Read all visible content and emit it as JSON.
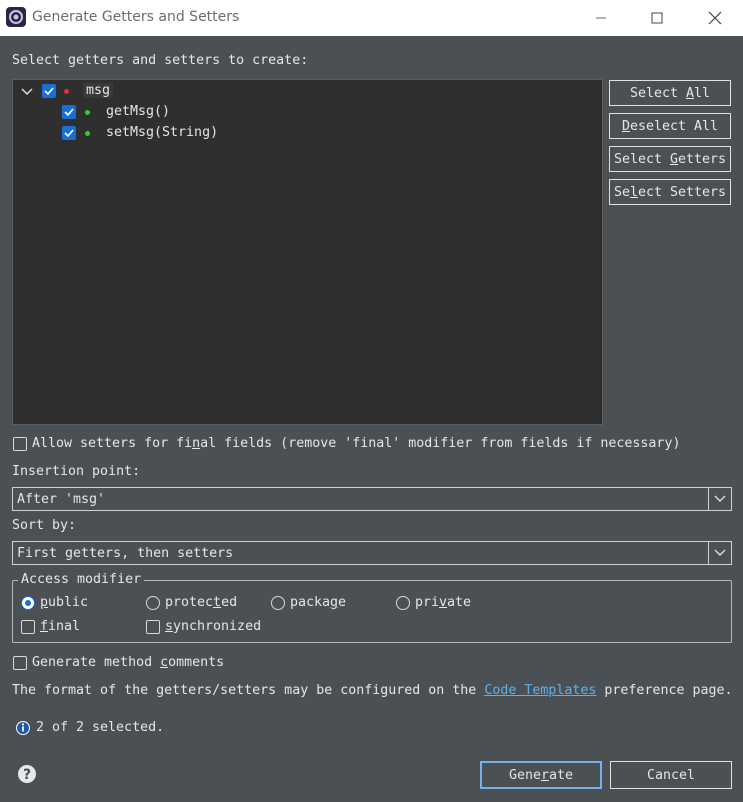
{
  "window": {
    "title": "Generate Getters and Setters",
    "minimize_icon": "minimize-icon",
    "maximize_icon": "maximize-icon",
    "close_icon": "close-icon"
  },
  "prompt": "Select getters and setters to create:",
  "tree": {
    "root": {
      "label": "msg",
      "checked": true,
      "icon": "field-private-icon"
    },
    "children": [
      {
        "label": "getMsg()",
        "checked": true,
        "icon": "method-public-icon"
      },
      {
        "label": "setMsg(String)",
        "checked": true,
        "icon": "method-public-icon"
      }
    ]
  },
  "side_buttons": {
    "select_all": {
      "pre": "Select ",
      "mn": "A",
      "post": "ll"
    },
    "deselect_all": {
      "pre": "",
      "mn": "D",
      "post": "eselect All"
    },
    "select_getters": {
      "pre": "Select ",
      "mn": "G",
      "post": "etters"
    },
    "select_setters": {
      "pre": "Se",
      "mn": "l",
      "post": "ect Setters"
    }
  },
  "allow_final": {
    "pre": "Allow setters for fi",
    "mn": "n",
    "post": "al fields (remove 'final' modifier from fields if necessary)",
    "checked": false
  },
  "insertion": {
    "label": "Insertion point:",
    "value": "After 'msg'"
  },
  "sort": {
    "label": "Sort by:",
    "value": "First getters, then setters"
  },
  "access": {
    "legend": "Access modifier",
    "public": {
      "pre": "",
      "mn": "p",
      "post": "ublic",
      "selected": true
    },
    "protected": {
      "pre": "protec",
      "mn": "t",
      "post": "ed",
      "selected": false
    },
    "package": {
      "pre": "packa",
      "mn": "g",
      "post": "e",
      "selected": false
    },
    "private": {
      "pre": "pri",
      "mn": "v",
      "post": "ate",
      "selected": false
    },
    "final": {
      "pre": "",
      "mn": "f",
      "post": "inal",
      "checked": false
    },
    "synchronized": {
      "pre": "",
      "mn": "s",
      "post": "ynchronized",
      "checked": false
    }
  },
  "comments": {
    "pre": "Generate method ",
    "mn": "c",
    "post": "omments",
    "checked": false
  },
  "info": {
    "pre": "The format of the getters/setters may be configured on the ",
    "link": "Code Templates",
    "post": " preference page."
  },
  "status": {
    "icon": "info-icon",
    "text": "2 of 2 selected."
  },
  "footer": {
    "help_icon": "help-icon",
    "generate": {
      "pre": "Gene",
      "mn": "r",
      "post": "ate"
    },
    "cancel": "Cancel"
  }
}
